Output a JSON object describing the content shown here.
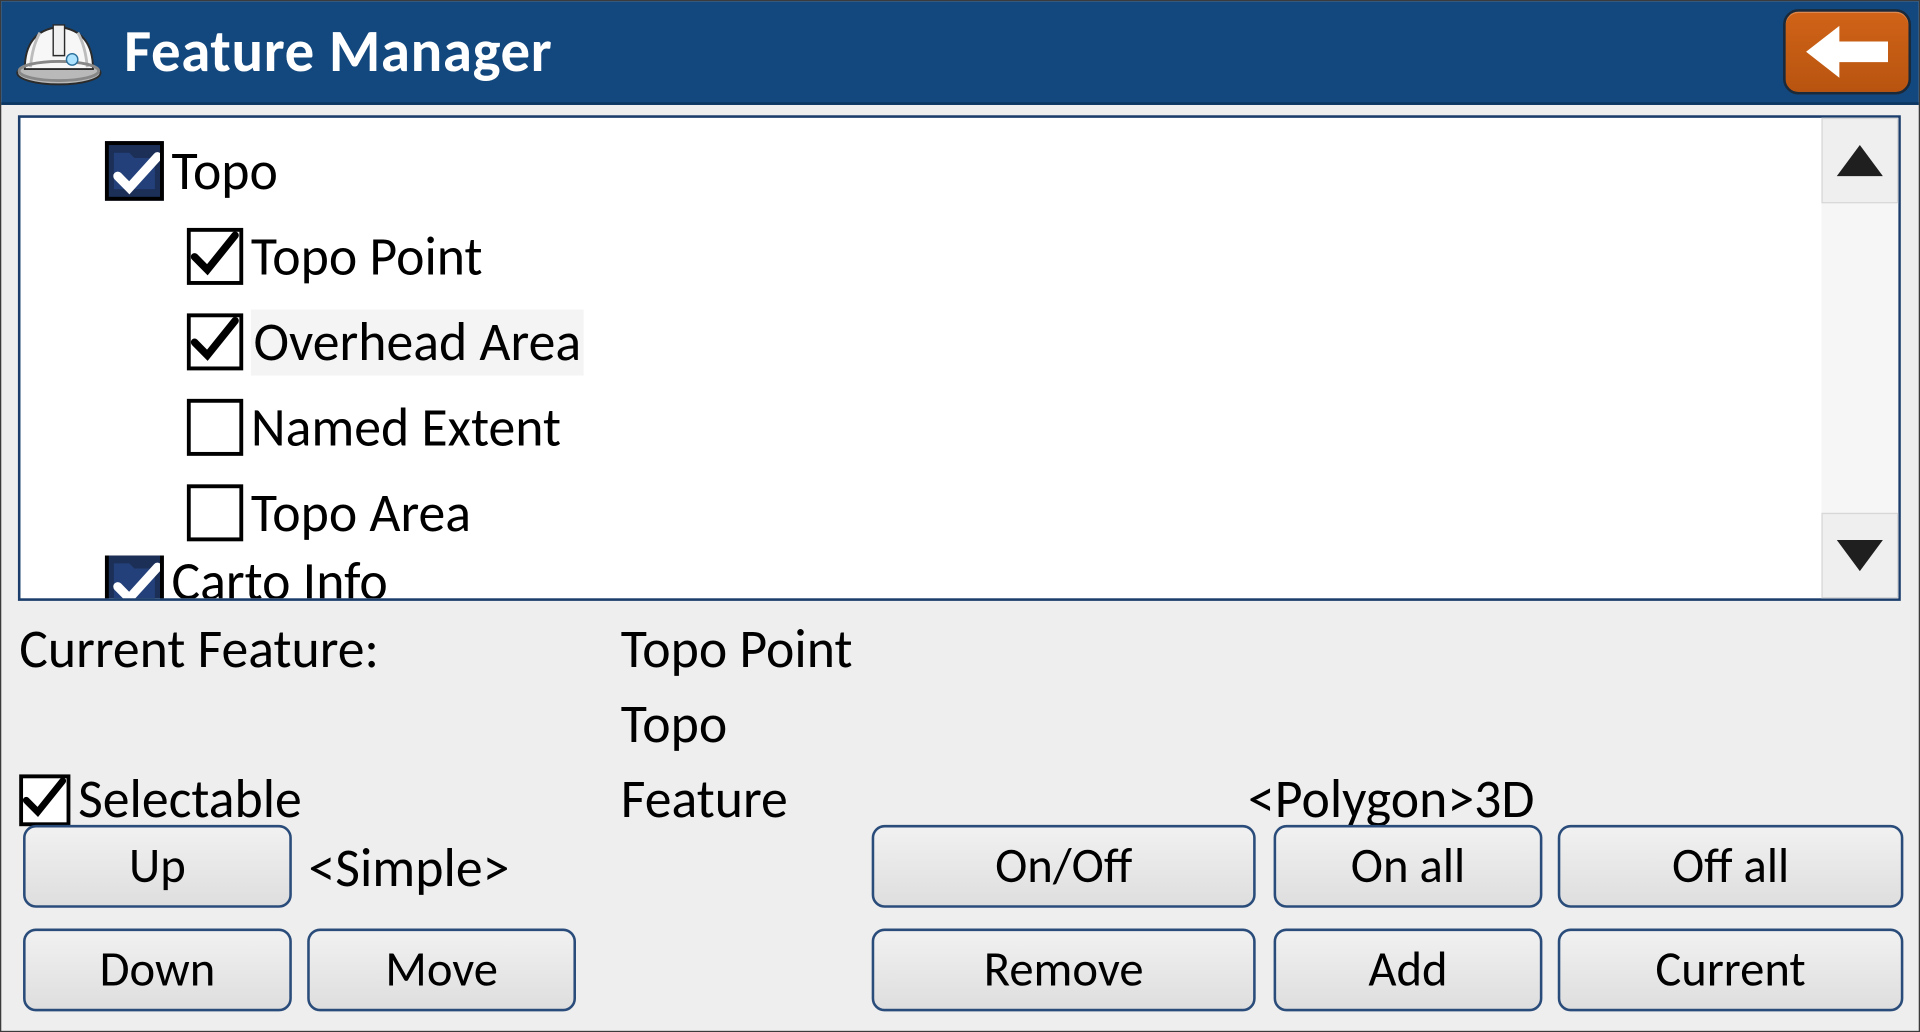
{
  "title": "Feature Manager",
  "tree": {
    "parent1": "Topo",
    "child1": "Topo Point",
    "child2": "Overhead Area",
    "child3": "Named Extent",
    "child4": "Topo Area",
    "parent2": "Carto Info"
  },
  "info": {
    "current_feature_label": "Current Feature:",
    "current_feature_value": "Topo Point",
    "group_value": "Topo",
    "selectable_label": "Selectable",
    "feature_label": "Feature",
    "polygon_label": "<Polygon>3D",
    "simple_label": "<Simple>"
  },
  "buttons": {
    "up": "Up",
    "down": "Down",
    "move": "Move",
    "onoff": "On/Off",
    "onall": "On all",
    "offall": "Off all",
    "remove": "Remove",
    "add": "Add",
    "current": "Current"
  }
}
